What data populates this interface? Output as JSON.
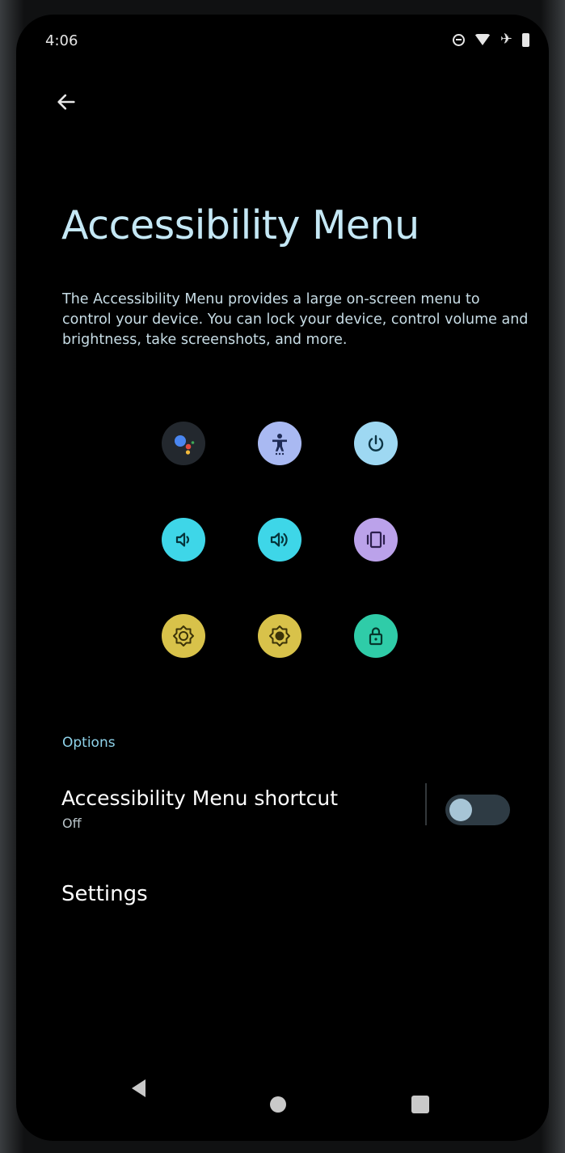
{
  "status_bar": {
    "time": "4:06",
    "icons": [
      "do-not-disturb-icon",
      "wifi-icon",
      "airplane-mode-icon",
      "battery-icon"
    ]
  },
  "header": {
    "back_icon": "arrow-left-icon"
  },
  "page": {
    "title": "Accessibility Menu",
    "description": "The Accessibility Menu provides a large on-screen menu to control your device. You can lock your device, control volume and brightness, take screenshots, and more."
  },
  "menu_tiles": [
    {
      "icon": "assistant-icon",
      "color": "#23282e"
    },
    {
      "icon": "accessibility-settings-icon",
      "color": "#a9b9f2"
    },
    {
      "icon": "power-icon",
      "color": "#9ed8f2"
    },
    {
      "icon": "volume-down-icon",
      "color": "#3ed6e8"
    },
    {
      "icon": "volume-up-icon",
      "color": "#3ed6e8"
    },
    {
      "icon": "recent-apps-vibrate-icon",
      "color": "#bba2ea"
    },
    {
      "icon": "brightness-down-icon",
      "color": "#d8c24a"
    },
    {
      "icon": "brightness-up-icon",
      "color": "#d8c24a"
    },
    {
      "icon": "lock-icon",
      "color": "#2fcca8"
    }
  ],
  "options": {
    "label": "Options",
    "shortcut": {
      "title": "Accessibility Menu shortcut",
      "status": "Off",
      "enabled": false
    },
    "settings_label": "Settings"
  },
  "navigation_bar": {
    "back_icon": "triangle-back-icon",
    "home_icon": "home-circle-icon",
    "recents_icon": "recents-square-icon"
  },
  "colors": {
    "background": "#000000",
    "title": "#c5e8f5",
    "accent": "#8fd3ea"
  }
}
